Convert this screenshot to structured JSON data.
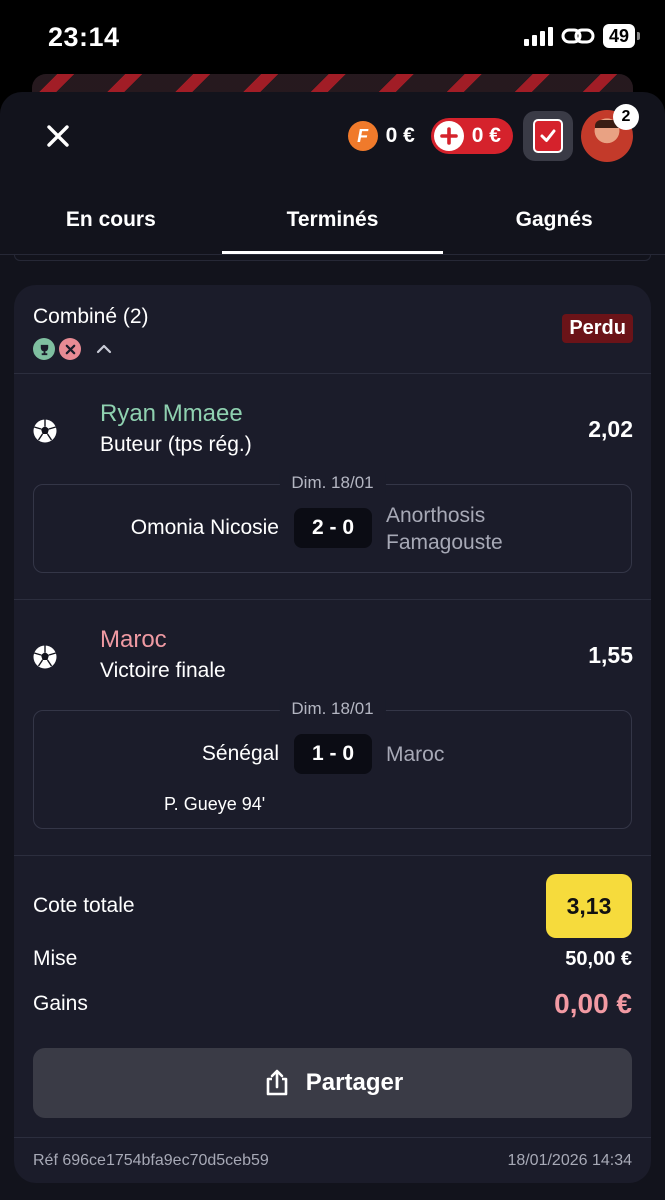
{
  "status_bar": {
    "time": "23:14",
    "battery": "49"
  },
  "header": {
    "wallet_balance": "0 €",
    "deposit_balance": "0 €",
    "notifications": "2"
  },
  "tabs": [
    {
      "label": "En cours"
    },
    {
      "label": "Terminés"
    },
    {
      "label": "Gagnés"
    }
  ],
  "active_tab": "Terminés",
  "bet": {
    "title": "Combiné (2)",
    "status": "Perdu",
    "selections": [
      {
        "name": "Ryan Mmaee",
        "result": "win",
        "market": "Buteur (tps rég.)",
        "odds": "2,02",
        "date": "Dim. 18/01",
        "home": "Omonia Nicosie",
        "score": "2 - 0",
        "away": "Anorthosis Famagouste"
      },
      {
        "name": "Maroc",
        "result": "lose",
        "market": "Victoire finale",
        "odds": "1,55",
        "date": "Dim. 18/01",
        "home": "Sénégal",
        "score": "1 - 0",
        "away": "Maroc",
        "scorer": "P. Gueye 94'"
      }
    ],
    "total_odds_label": "Cote totale",
    "total_odds": "3,13",
    "stake_label": "Mise",
    "stake": "50,00 €",
    "gains_label": "Gains",
    "gains": "0,00 €",
    "share_label": "Partager",
    "reference": "Réf 696ce1754bfa9ec70d5ceb59",
    "datetime": "18/01/2026 14:34"
  },
  "colors": {
    "sheet_bg": "#12131c",
    "card_bg": "#1b1c2a",
    "accent_red": "#d5222c",
    "win_green": "#8fd1b0",
    "lose_pink": "#f09aa3",
    "odds_yellow": "#f6db3c"
  },
  "icons": [
    "close-icon",
    "f-coin-icon",
    "plus-icon",
    "bets-check-icon",
    "avatar",
    "trophy-icon",
    "cross-icon",
    "chevron-up-icon",
    "football-icon",
    "share-icon"
  ]
}
